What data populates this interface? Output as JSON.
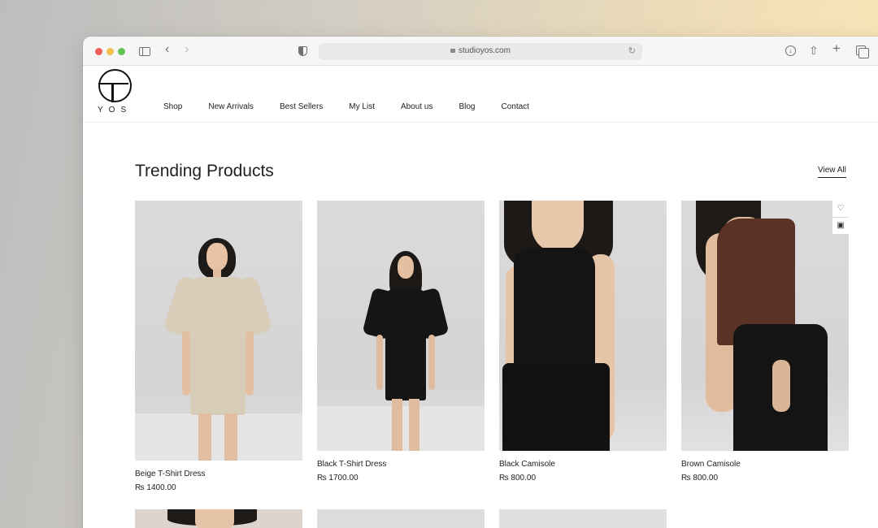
{
  "browser": {
    "url": "studioyos.com"
  },
  "site": {
    "logo_text": "YOS",
    "nav": [
      "Shop",
      "New Arrivals",
      "Best Sellers",
      "My List",
      "About us",
      "Blog",
      "Contact"
    ]
  },
  "section": {
    "title": "Trending Products",
    "view_all": "View All"
  },
  "products": [
    {
      "name": "Beige T-Shirt Dress",
      "price": "₨ 1400.00",
      "color": "#d8cdb8"
    },
    {
      "name": "Black T-Shirt Dress",
      "price": "₨ 1700.00",
      "color": "#151515"
    },
    {
      "name": "Black Camisole",
      "price": "₨ 800.00",
      "color": "#141414"
    },
    {
      "name": "Brown Camisole",
      "price": "₨ 800.00",
      "color": "#5a3326"
    }
  ]
}
